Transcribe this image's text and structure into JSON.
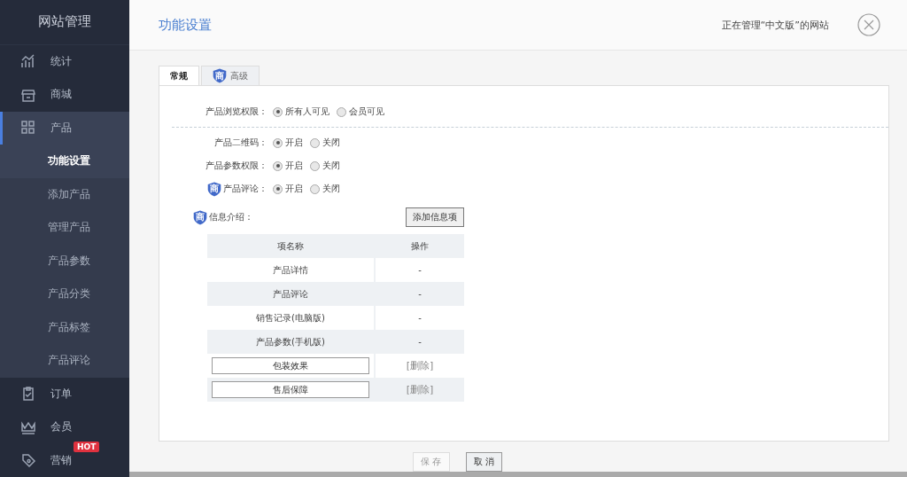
{
  "sidebar": {
    "title": "网站管理",
    "items": [
      {
        "kind": "chart",
        "label": "统计",
        "selected": false
      },
      {
        "kind": "shop",
        "label": "商城",
        "selected": false
      },
      {
        "kind": "grid",
        "label": "产品",
        "selected": true,
        "expanded": true,
        "children": [
          {
            "label": "功能设置",
            "selected": true
          },
          {
            "label": "添加产品",
            "selected": false
          },
          {
            "label": "管理产品",
            "selected": false
          },
          {
            "label": "产品参数",
            "selected": false
          },
          {
            "label": "产品分类",
            "selected": false
          },
          {
            "label": "产品标签",
            "selected": false
          },
          {
            "label": "产品评论",
            "selected": false
          }
        ]
      },
      {
        "kind": "clipboard",
        "label": "订单",
        "selected": false
      },
      {
        "kind": "crown",
        "label": "会员",
        "selected": false
      },
      {
        "kind": "tag",
        "label": "营销",
        "selected": false,
        "badge": "HOT"
      }
    ]
  },
  "header": {
    "title": "功能设置",
    "context": "正在管理“中文版”的网站"
  },
  "tabs": [
    {
      "label": "常规",
      "selected": true
    },
    {
      "label": "高级",
      "selected": false,
      "shield": "商"
    }
  ],
  "settings": [
    {
      "label": "产品浏览权限：",
      "options": [
        {
          "label": "所有人可见",
          "selected": true
        },
        {
          "label": "会员可见",
          "selected": false
        }
      ]
    },
    {
      "label": "产品二维码：",
      "options": [
        {
          "label": "开启",
          "selected": true
        },
        {
          "label": "关闭",
          "selected": false
        }
      ]
    },
    {
      "label": "产品参数权限：",
      "options": [
        {
          "label": "开启",
          "selected": true
        },
        {
          "label": "关闭",
          "selected": false
        }
      ]
    },
    {
      "label": "产品评论：",
      "shield": "商",
      "options": [
        {
          "label": "开启",
          "selected": true
        },
        {
          "label": "关闭",
          "selected": false
        }
      ]
    }
  ],
  "info": {
    "label": "信息介绍：",
    "shield": "商",
    "add_button": "添加信息项",
    "columns": [
      "项名称",
      "操作"
    ],
    "rows": [
      {
        "kind": "fixed",
        "name": "产品详情",
        "action": "-"
      },
      {
        "kind": "fixed",
        "name": "产品评论",
        "action": "-"
      },
      {
        "kind": "fixed",
        "name": "销售记录(电脑版)",
        "action": "-"
      },
      {
        "kind": "fixed",
        "name": "产品参数(手机版)",
        "action": "-"
      },
      {
        "kind": "custom",
        "name": "包装效果",
        "action": "[删除]"
      },
      {
        "kind": "custom",
        "name": "售后保障",
        "action": "[删除]"
      }
    ]
  },
  "buttons": [
    {
      "label": "保 存",
      "disabled": true
    },
    {
      "label": "取 消",
      "disabled": false
    }
  ]
}
